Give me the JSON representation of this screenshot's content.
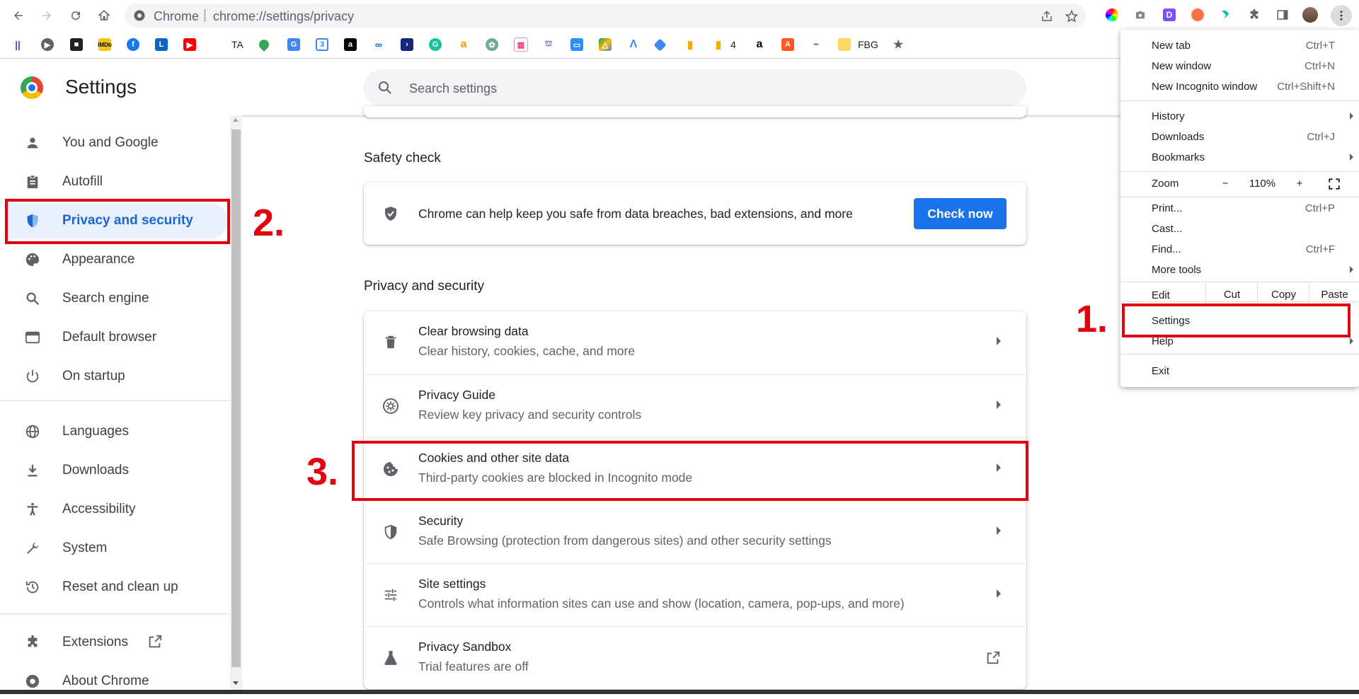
{
  "toolbar": {
    "chrome_label": "Chrome",
    "separator": "|",
    "url": "chrome://settings/privacy"
  },
  "bookmarks": {
    "items": [
      {
        "label": "TA"
      },
      {
        "label": "4"
      },
      {
        "label": "FBG"
      }
    ]
  },
  "header": {
    "title": "Settings",
    "search_placeholder": "Search settings"
  },
  "sidebar": {
    "items": [
      {
        "label": "You and Google"
      },
      {
        "label": "Autofill"
      },
      {
        "label": "Privacy and security"
      },
      {
        "label": "Appearance"
      },
      {
        "label": "Search engine"
      },
      {
        "label": "Default browser"
      },
      {
        "label": "On startup"
      },
      {
        "label": "Languages"
      },
      {
        "label": "Downloads"
      },
      {
        "label": "Accessibility"
      },
      {
        "label": "System"
      },
      {
        "label": "Reset and clean up"
      },
      {
        "label": "Extensions"
      },
      {
        "label": "About Chrome"
      }
    ]
  },
  "safety_check": {
    "section_title": "Safety check",
    "text": "Chrome can help keep you safe from data breaches, bad extensions, and more",
    "button": "Check now"
  },
  "privacy": {
    "section_title": "Privacy and security",
    "rows": [
      {
        "title": "Clear browsing data",
        "subtitle": "Clear history, cookies, cache, and more"
      },
      {
        "title": "Privacy Guide",
        "subtitle": "Review key privacy and security controls"
      },
      {
        "title": "Cookies and other site data",
        "subtitle": "Third-party cookies are blocked in Incognito mode"
      },
      {
        "title": "Security",
        "subtitle": "Safe Browsing (protection from dangerous sites) and other security settings"
      },
      {
        "title": "Site settings",
        "subtitle": "Controls what information sites can use and show (location, camera, pop-ups, and more)"
      },
      {
        "title": "Privacy Sandbox",
        "subtitle": "Trial features are off"
      }
    ]
  },
  "menu": {
    "new_tab": "New tab",
    "new_tab_sc": "Ctrl+T",
    "new_window": "New window",
    "new_window_sc": "Ctrl+N",
    "incognito": "New Incognito window",
    "incognito_sc": "Ctrl+Shift+N",
    "history": "History",
    "downloads": "Downloads",
    "downloads_sc": "Ctrl+J",
    "bookmarks": "Bookmarks",
    "zoom": "Zoom",
    "zoom_minus": "−",
    "zoom_value": "110%",
    "zoom_plus": "+",
    "print": "Print...",
    "print_sc": "Ctrl+P",
    "cast": "Cast...",
    "find": "Find...",
    "find_sc": "Ctrl+F",
    "more_tools": "More tools",
    "edit": "Edit",
    "cut": "Cut",
    "copy": "Copy",
    "paste": "Paste",
    "settings": "Settings",
    "help": "Help",
    "exit": "Exit"
  },
  "annotations": {
    "step1": "1.",
    "step2": "2.",
    "step3": "3."
  },
  "colors": {
    "accent": "#1a73e8",
    "active_nav_bg": "#e8f0fe",
    "annotation_red": "#e3000f"
  }
}
